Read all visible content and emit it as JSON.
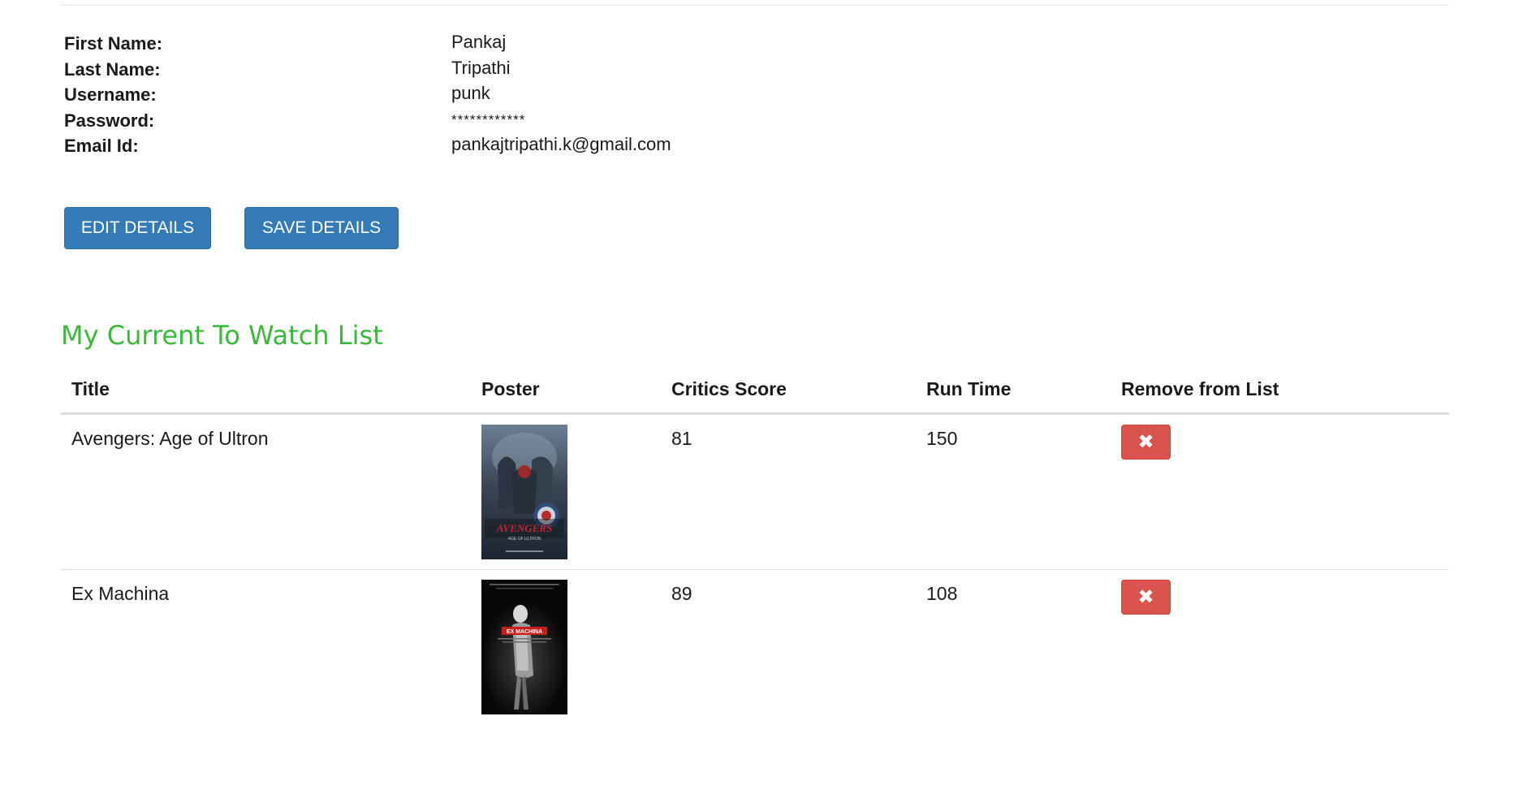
{
  "profile": {
    "fields": [
      {
        "label": "First Name:",
        "value": "Pankaj"
      },
      {
        "label": "Last Name:",
        "value": "Tripathi"
      },
      {
        "label": "Username:",
        "value": "punk"
      },
      {
        "label": "Password:",
        "value": "************"
      },
      {
        "label": "Email Id:",
        "value": "pankajtripathi.k@gmail.com"
      }
    ],
    "edit_label": "EDIT DETAILS",
    "save_label": "SAVE DETAILS"
  },
  "watchlist": {
    "title": "My Current To Watch List",
    "columns": [
      "Title",
      "Poster",
      "Critics Score",
      "Run Time",
      "Remove from List"
    ],
    "rows": [
      {
        "title": "Avengers: Age of Ultron",
        "critics_score": "81",
        "run_time": "150",
        "poster_logo": "AVENGERS",
        "poster_subtitle": "AGE OF ULTRON"
      },
      {
        "title": "Ex Machina",
        "critics_score": "89",
        "run_time": "108",
        "poster_logo": "EX MACHINA"
      }
    ],
    "remove_icon": "times-icon"
  },
  "colors": {
    "primary_button": "#337ab7",
    "danger_button": "#d9534f",
    "section_title": "#3cb93c"
  }
}
